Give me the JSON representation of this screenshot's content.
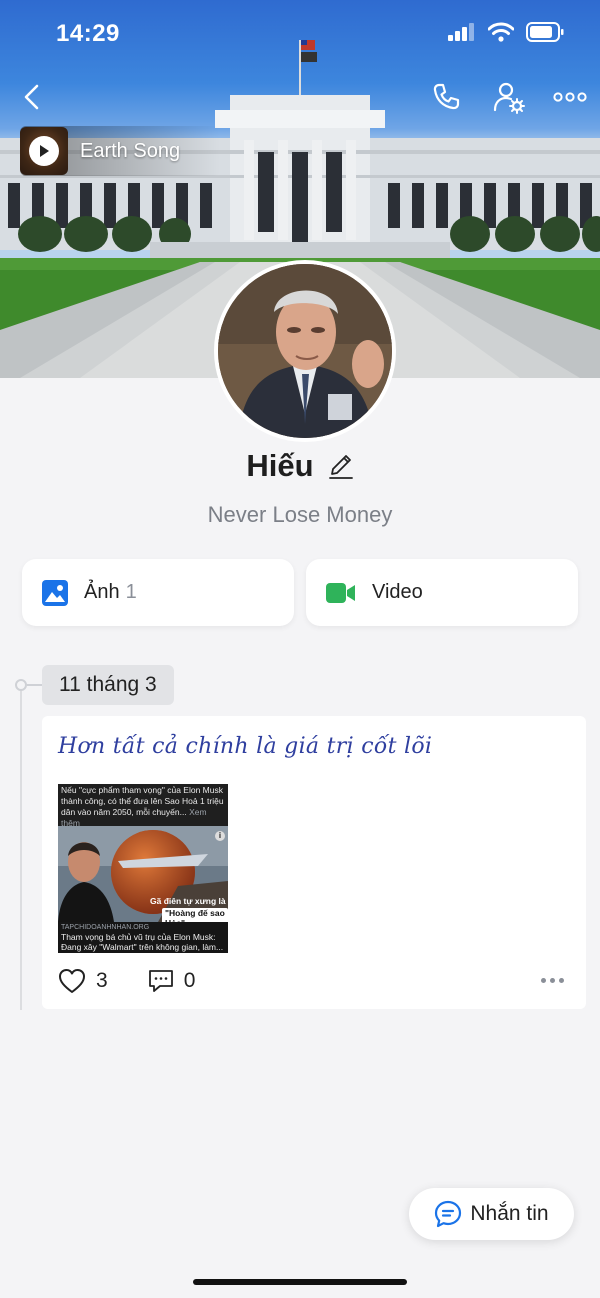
{
  "status_bar": {
    "time": "14:29"
  },
  "music": {
    "title": "Earth Song"
  },
  "profile": {
    "name": "Hiếu",
    "bio": "Never Lose Money"
  },
  "media": {
    "photos": {
      "label": "Ảnh",
      "count": "1"
    },
    "videos": {
      "label": "Video"
    }
  },
  "timeline": {
    "date": "11 tháng 3",
    "post": {
      "text": "Hơn tất cả chính là giá trị cốt lõi",
      "link_preview": {
        "top_text": "Nếu \"cực phẩm tham vọng\" của Elon Musk thành công, có thể đưa lên Sao Hoả 1 triệu dân vào năm 2050, mỗi chuyến...",
        "more": "Xem thêm",
        "image_caption_a": "Gã điên tự xưng là",
        "image_caption_b": "\"Hoàng đế sao Hỏa\"",
        "source": "TAPCHIDOANHNHAN.ORG",
        "title": "Tham vọng bá chủ vũ trụ của Elon Musk: Đang xây \"Walmart\" trên không gian, làm..."
      },
      "likes": "3",
      "comments": "0"
    }
  },
  "message_button": {
    "label": "Nhắn tin"
  },
  "colors": {
    "accent_blue": "#1a73e8",
    "video_green": "#2fb35a",
    "post_text": "#2f3f9f"
  }
}
